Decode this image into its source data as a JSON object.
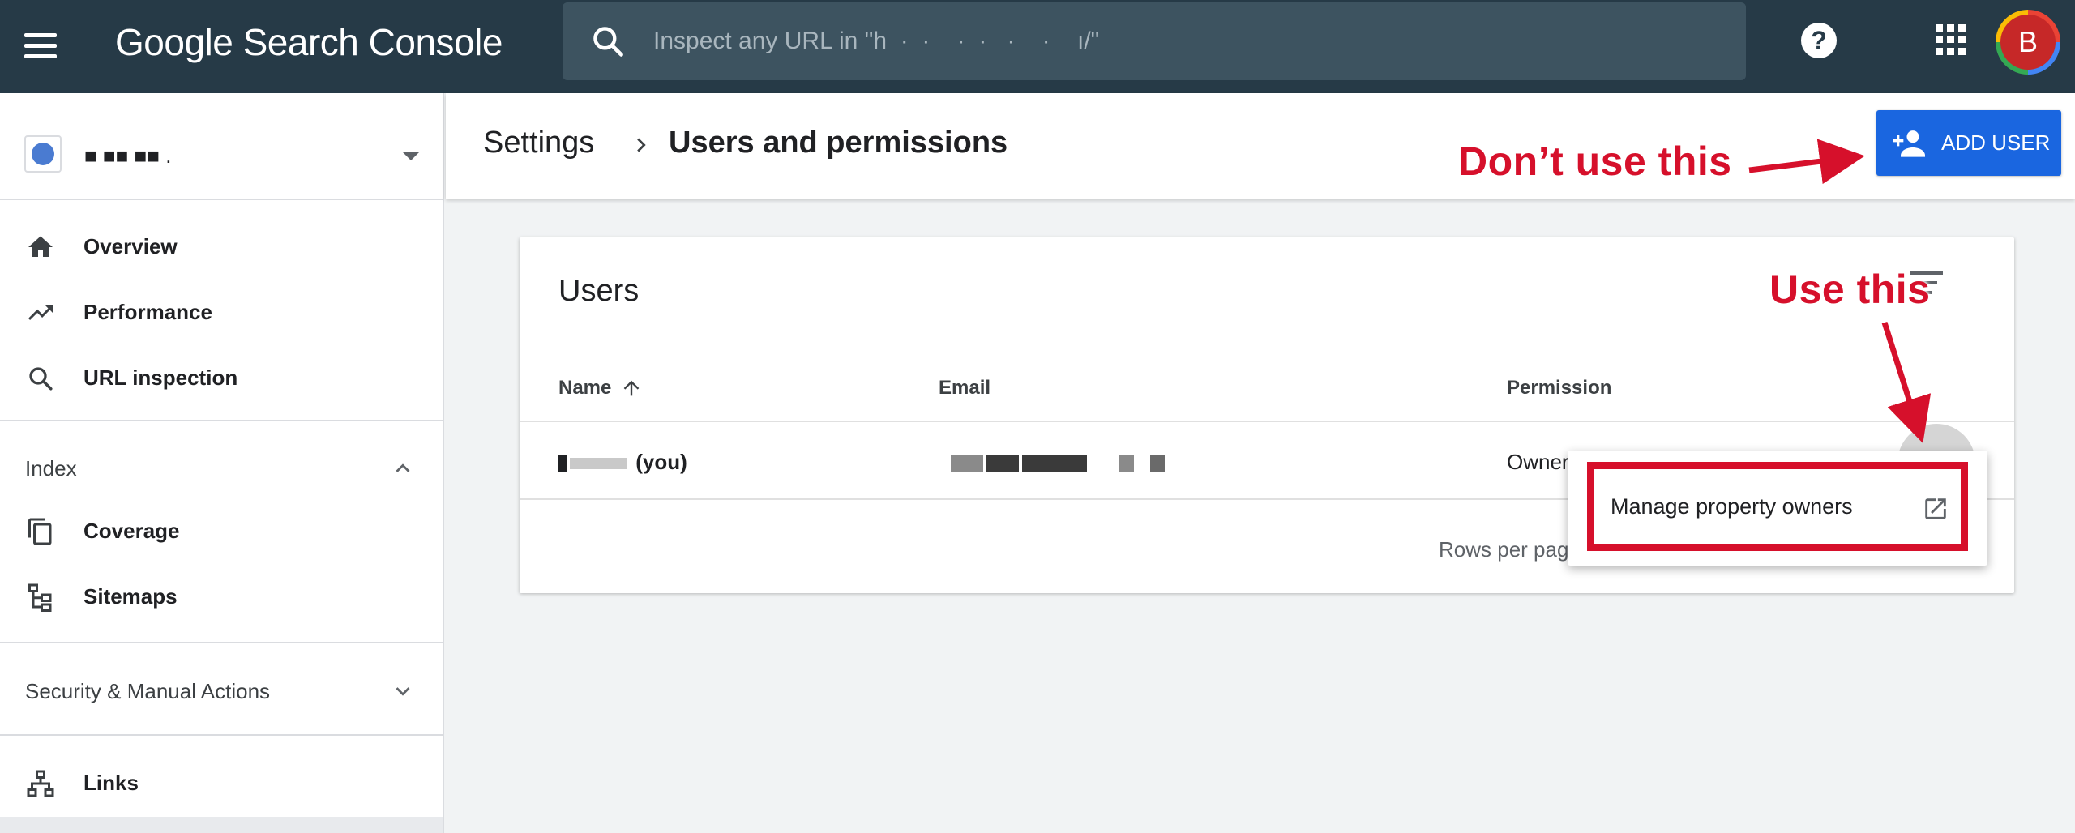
{
  "app": {
    "title": "Google Search Console"
  },
  "search": {
    "placeholder": "Inspect any URL in \"h  ·  ·    ·  ·   ·    ·    ı/\""
  },
  "topbar": {
    "avatar_letter": "B"
  },
  "sidebar": {
    "property_name": "■           ■■  ■■   .",
    "items_top": [
      {
        "label": "Overview",
        "icon": "home-icon"
      },
      {
        "label": "Performance",
        "icon": "trending-up-icon"
      },
      {
        "label": "URL inspection",
        "icon": "search-icon"
      }
    ],
    "index_label": "Index",
    "index_items": [
      {
        "label": "Coverage",
        "icon": "copy-icon"
      },
      {
        "label": "Sitemaps",
        "icon": "sitemap-icon"
      }
    ],
    "security_label": "Security & Manual Actions",
    "links_label": "Links"
  },
  "header": {
    "breadcrumb_parent": "Settings",
    "breadcrumb_current": "Users and permissions",
    "add_user_label": "ADD USER"
  },
  "users_card": {
    "title": "Users",
    "columns": {
      "name": "Name",
      "email": "Email",
      "permission": "Permission"
    },
    "rows": [
      {
        "name_suffix": "(you)",
        "permission": "Owner"
      }
    ],
    "rows_per_page_label": "Rows per pag"
  },
  "menu": {
    "manage_owners_label": "Manage property owners"
  },
  "annotations": {
    "dont_use": "Don’t use this",
    "use_this": "Use this"
  },
  "colors": {
    "topbar": "#263a47",
    "primary": "#1a66e0",
    "annotation_red": "#d6102b"
  }
}
